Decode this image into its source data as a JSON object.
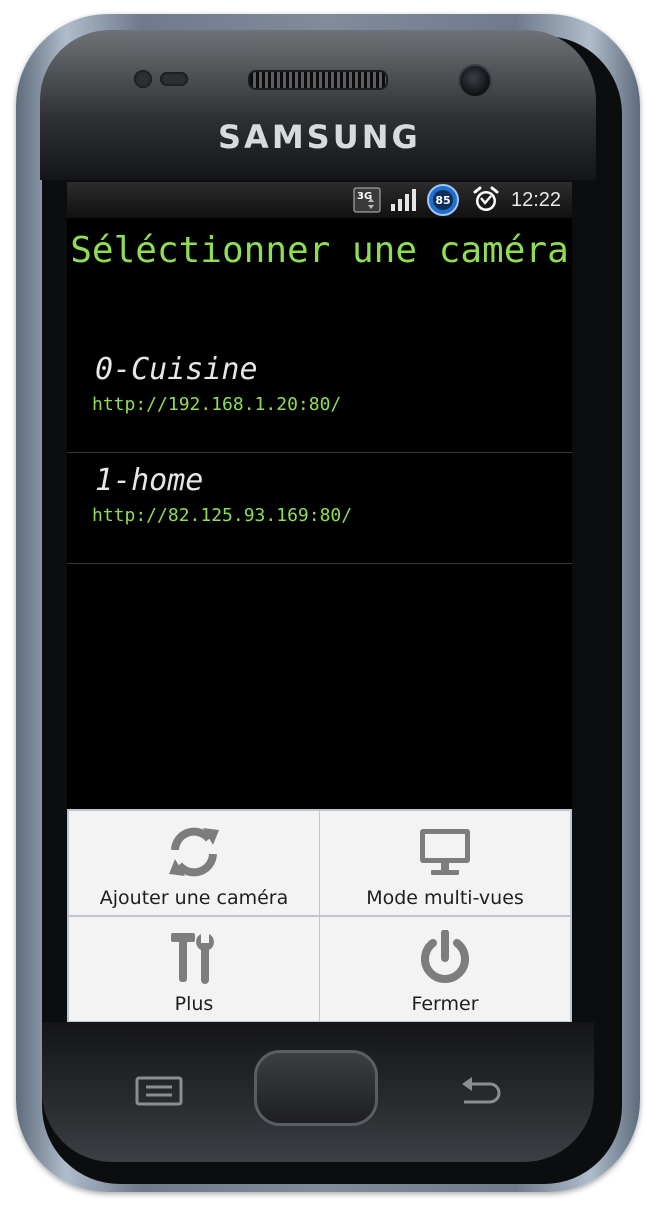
{
  "device": {
    "brand": "SAMSUNG"
  },
  "status_bar": {
    "network_type": "3G",
    "battery_level": "85",
    "time": "12:22",
    "icons": [
      "3g-data-icon",
      "signal-strength-icon",
      "battery-icon",
      "alarm-clock-icon"
    ]
  },
  "screen": {
    "title": "Séléctionner une caméra"
  },
  "cameras": [
    {
      "name": "0-Cuisine",
      "url": "http://192.168.1.20:80/"
    },
    {
      "name": "1-home",
      "url": "http://82.125.93.169:80/"
    }
  ],
  "menu": {
    "items": [
      {
        "label": "Ajouter une caméra",
        "icon": "refresh-icon"
      },
      {
        "label": "Mode multi-vues",
        "icon": "monitor-icon"
      },
      {
        "label": "Plus",
        "icon": "tools-icon"
      },
      {
        "label": "Fermer",
        "icon": "power-icon"
      }
    ]
  },
  "hardware_keys": [
    "menu-key-icon",
    "home-button",
    "back-key-icon"
  ],
  "colors": {
    "title_green": "#8fdd54",
    "url_green": "#8fdd54",
    "camera_name": "#e6e6e6",
    "menu_background": "#f3f3f3",
    "menu_divider": "#b9c7d6",
    "screen_background": "#000000"
  }
}
